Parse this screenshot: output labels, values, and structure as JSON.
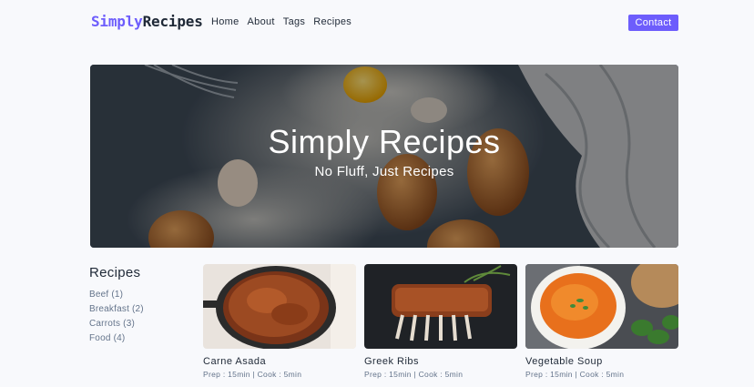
{
  "nav": {
    "logo_brand": "Simply",
    "logo_rest": "Recipes",
    "links": [
      "Home",
      "About",
      "Tags",
      "Recipes"
    ],
    "contact_label": "Contact"
  },
  "hero": {
    "title": "Simply Recipes",
    "subtitle": "No Fluff, Just Recipes"
  },
  "sidebar": {
    "title": "Recipes",
    "tags": [
      "Beef (1)",
      "Breakfast (2)",
      "Carrots (3)",
      "Food (4)"
    ]
  },
  "recipes": [
    {
      "name": "Carne Asada",
      "meta": "Prep : 15min | Cook : 5min"
    },
    {
      "name": "Greek Ribs",
      "meta": "Prep : 15min | Cook : 5min"
    },
    {
      "name": "Vegetable Soup",
      "meta": "Prep : 15min | Cook : 5min"
    }
  ],
  "colors": {
    "accent": "#6d5dfc",
    "text": "#1f2937",
    "muted": "#64748b",
    "background": "#f8f9fc"
  }
}
